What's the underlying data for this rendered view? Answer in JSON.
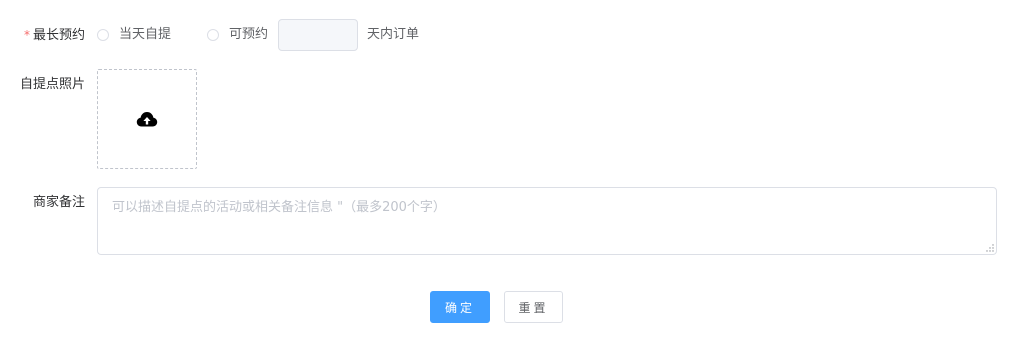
{
  "form": {
    "max_booking": {
      "required_mark": "*",
      "label": "最长预约",
      "option_same_day": "当天自提",
      "option_bookable": "可预约",
      "days_value": "",
      "days_placeholder": "",
      "suffix": "天内订单"
    },
    "photo": {
      "label": "自提点照片",
      "upload_icon": "cloud-upload-icon"
    },
    "note": {
      "label": "商家备注",
      "value": "",
      "placeholder": "可以描述自提点的活动或相关备注信息 \"（最多200个字）"
    }
  },
  "actions": {
    "confirm_label": "确定",
    "reset_label": "重置"
  },
  "colors": {
    "primary": "#409eff",
    "required": "#f56c6c",
    "border": "#dcdfe6",
    "placeholder": "#c0c4cc"
  }
}
